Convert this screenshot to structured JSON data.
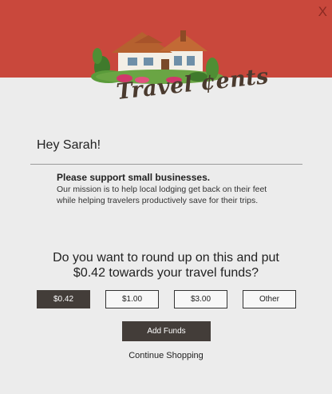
{
  "header": {
    "brand_color": "#c9483c",
    "close_label": "X",
    "logo_text": "Travel ¢ents",
    "logo_icon": "house-icon"
  },
  "greeting": "Hey Sarah!",
  "support": {
    "title": "Please support small businesses.",
    "body": "Our mission is to help local lodging get back on their feet while helping travelers productively save for their trips."
  },
  "question": {
    "line1": "Do you want to round up on this and put",
    "line2": "$0.42 towards your travel funds?"
  },
  "amounts": {
    "options": [
      "$0.42",
      "$1.00",
      "$3.00",
      "Other"
    ],
    "selected": "$0.42"
  },
  "actions": {
    "add_funds_label": "Add Funds",
    "continue_label": "Continue Shopping"
  },
  "colors": {
    "button_dark": "#433d39",
    "background": "#ececec"
  }
}
